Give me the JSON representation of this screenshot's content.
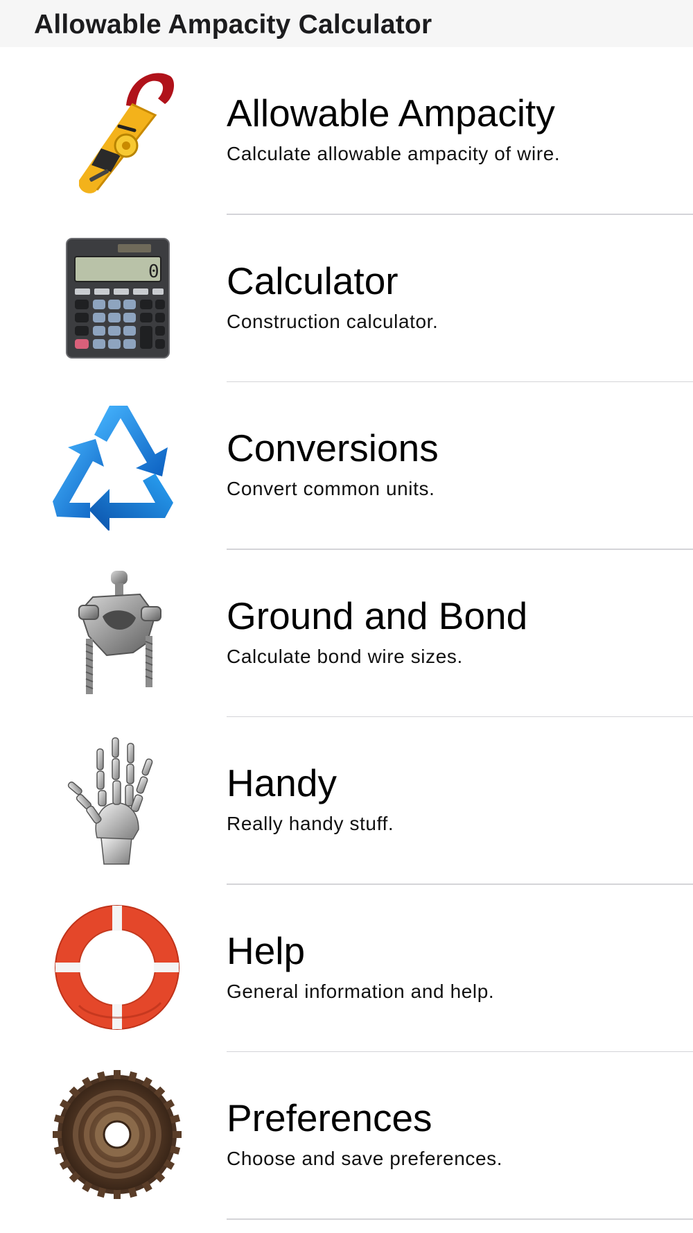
{
  "header": {
    "title": "Allowable Ampacity Calculator"
  },
  "menu": {
    "items": [
      {
        "title": "Allowable Ampacity",
        "subtitle": "Calculate allowable ampacity of wire.",
        "icon": "clamp-meter-icon"
      },
      {
        "title": "Calculator",
        "subtitle": "Construction calculator.",
        "icon": "calculator-icon"
      },
      {
        "title": "Conversions",
        "subtitle": "Convert common units.",
        "icon": "recycle-arrows-icon"
      },
      {
        "title": "Ground and Bond",
        "subtitle": "Calculate bond wire sizes.",
        "icon": "ground-clamp-icon"
      },
      {
        "title": "Handy",
        "subtitle": "Really handy stuff.",
        "icon": "skeleton-hand-icon"
      },
      {
        "title": "Help",
        "subtitle": "General information and help.",
        "icon": "life-ring-icon"
      },
      {
        "title": "Preferences",
        "subtitle": "Choose and save preferences.",
        "icon": "gear-cassette-icon"
      }
    ]
  },
  "colors": {
    "header_background": "#f6f6f6",
    "separator": "#d4d4d8",
    "text": "#000000"
  }
}
